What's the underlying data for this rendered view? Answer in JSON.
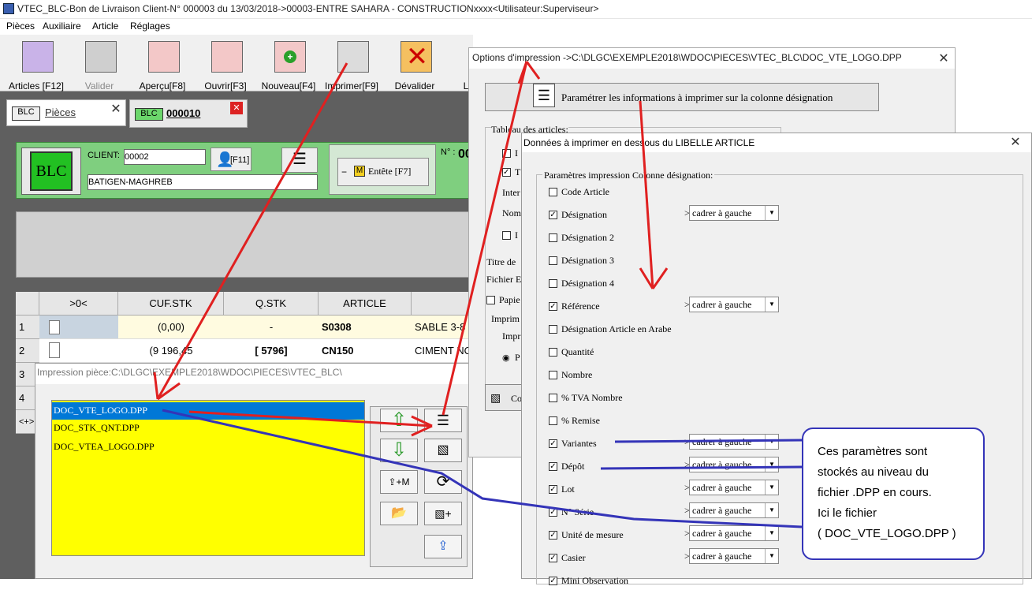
{
  "window_title": "VTEC_BLC-Bon de Livraison Client-N° 000003 du 13/03/2018->00003-ENTRE SAHARA - CONSTRUCTIONxxxx<Utilisateur:Superviseur>",
  "menu": [
    "Pièces",
    "Auxiliaire",
    "Article",
    "Réglages"
  ],
  "toolbar": [
    {
      "label": "Articles [F12]",
      "icon": "articles-grid-icon"
    },
    {
      "label": "Valider",
      "icon": "validate-icon"
    },
    {
      "label": "Aperçu[F8]",
      "icon": "preview-icon"
    },
    {
      "label": "Ouvrir[F3]",
      "icon": "open-icon"
    },
    {
      "label": "Nouveau[F4]",
      "icon": "new-icon"
    },
    {
      "label": "Imprimer[F9]",
      "icon": "printer-icon"
    },
    {
      "label": "Dévalider",
      "icon": "unvalidate-icon"
    },
    {
      "label": "L",
      "icon": "other-icon"
    }
  ],
  "tabs": {
    "tab1_badge": "BLC",
    "tab1_label": "Pièces",
    "tab2_badge": "BLC",
    "tab2_label": "000010"
  },
  "client": {
    "label": "CLIENT:",
    "code": "00002",
    "name": "BATIGEN-MAGHREB",
    "f11": "[F11]",
    "entete_badge": "M",
    "entete": "Entête [F7]",
    "logo": "BLC",
    "no_label": "N° :",
    "no_value": "00"
  },
  "grid": {
    "headers": [
      ">0<",
      "CUF.STK",
      "Q.STK",
      "ARTICLE"
    ],
    "rows": [
      {
        "n": "1",
        "cuf": "(0,00)",
        "q": "-",
        "art": "S0308",
        "des": "SABLE 3-8"
      },
      {
        "n": "2",
        "cuf": "(9 196,45",
        "q": "[ 5796]",
        "art": "CN150",
        "des": "CIMENT NO"
      },
      {
        "n": "3"
      },
      {
        "n": "4"
      },
      {
        "n": "<+>"
      }
    ]
  },
  "impression": {
    "title": "Impression pièce:C:\\DLGC\\EXEMPLE2018\\WDOC\\PIECES\\VTEC_BLC\\",
    "files": [
      "DOC_VTE_LOGO.DPP",
      "DOC_STK_QNT.DPP",
      "DOC_VTEA_LOGO.DPP"
    ],
    "addm": "+M"
  },
  "options": {
    "title": "Options d'impression ->C:\\DLGC\\EXEMPLE2018\\WDOC\\PIECES\\VTEC_BLC\\DOC_VTE_LOGO.DPP",
    "param_button": "Paramétrer les informations à imprimer sur la colonne désignation",
    "tableau": "Tableau des articles:",
    "frag": {
      "i1": "I",
      "t": "T",
      "inter": "Inter",
      "nom": "Nom",
      "i2": "I",
      "titre": "Titre de",
      "fichier": "Fichier E",
      "papier": "Papie",
      "impr": "Imprim",
      "impr2": "Impr",
      "p": "P",
      "co": "Co"
    }
  },
  "donnees": {
    "title": "Données à imprimer en dessous du LIBELLE ARTICLE",
    "group": "Paramètres impression Colonne désignation:",
    "items": [
      {
        "label": "Code Article",
        "checked": false,
        "align": ""
      },
      {
        "label": "Désignation",
        "checked": true,
        "align": "cadrer à gauche"
      },
      {
        "label": "Désignation 2",
        "checked": false,
        "align": ""
      },
      {
        "label": "Désignation 3",
        "checked": false,
        "align": ""
      },
      {
        "label": "Désignation 4",
        "checked": false,
        "align": ""
      },
      {
        "label": "Référence",
        "checked": true,
        "align": "cadrer à gauche"
      },
      {
        "label": "Désignation Article en Arabe",
        "checked": false,
        "align": ""
      },
      {
        "label": "Quantité",
        "checked": false,
        "align": ""
      },
      {
        "label": "Nombre",
        "checked": false,
        "align": ""
      },
      {
        "label": "% TVA Nombre",
        "checked": false,
        "align": ""
      },
      {
        "label": "% Remise",
        "checked": false,
        "align": ""
      },
      {
        "label": "Variantes",
        "checked": true,
        "align": "cadrer à gauche"
      },
      {
        "label": "Dépôt",
        "checked": true,
        "align": "cadrer à gauche"
      },
      {
        "label": "Lot",
        "checked": true,
        "align": "cadrer à gauche"
      },
      {
        "label": "N° Série",
        "checked": true,
        "align": "cadrer à gauche"
      },
      {
        "label": "Unité de mesure",
        "checked": true,
        "align": "cadrer à gauche"
      },
      {
        "label": "Casier",
        "checked": true,
        "align": "cadrer à gauche"
      },
      {
        "label": "Mini Observation",
        "checked": true,
        "align": ""
      }
    ]
  },
  "callout": {
    "lines": [
      "Ces paramètres sont",
      "stockés au niveau du",
      "fichier .DPP en cours.",
      "Ici  le fichier",
      "( DOC_VTE_LOGO.DPP )"
    ]
  },
  "colors": {
    "green": "#7fcf7f",
    "yellow": "#ffff00",
    "selection": "#0078d7",
    "red_arrow": "#e02020",
    "blue_line": "#3434b8"
  }
}
